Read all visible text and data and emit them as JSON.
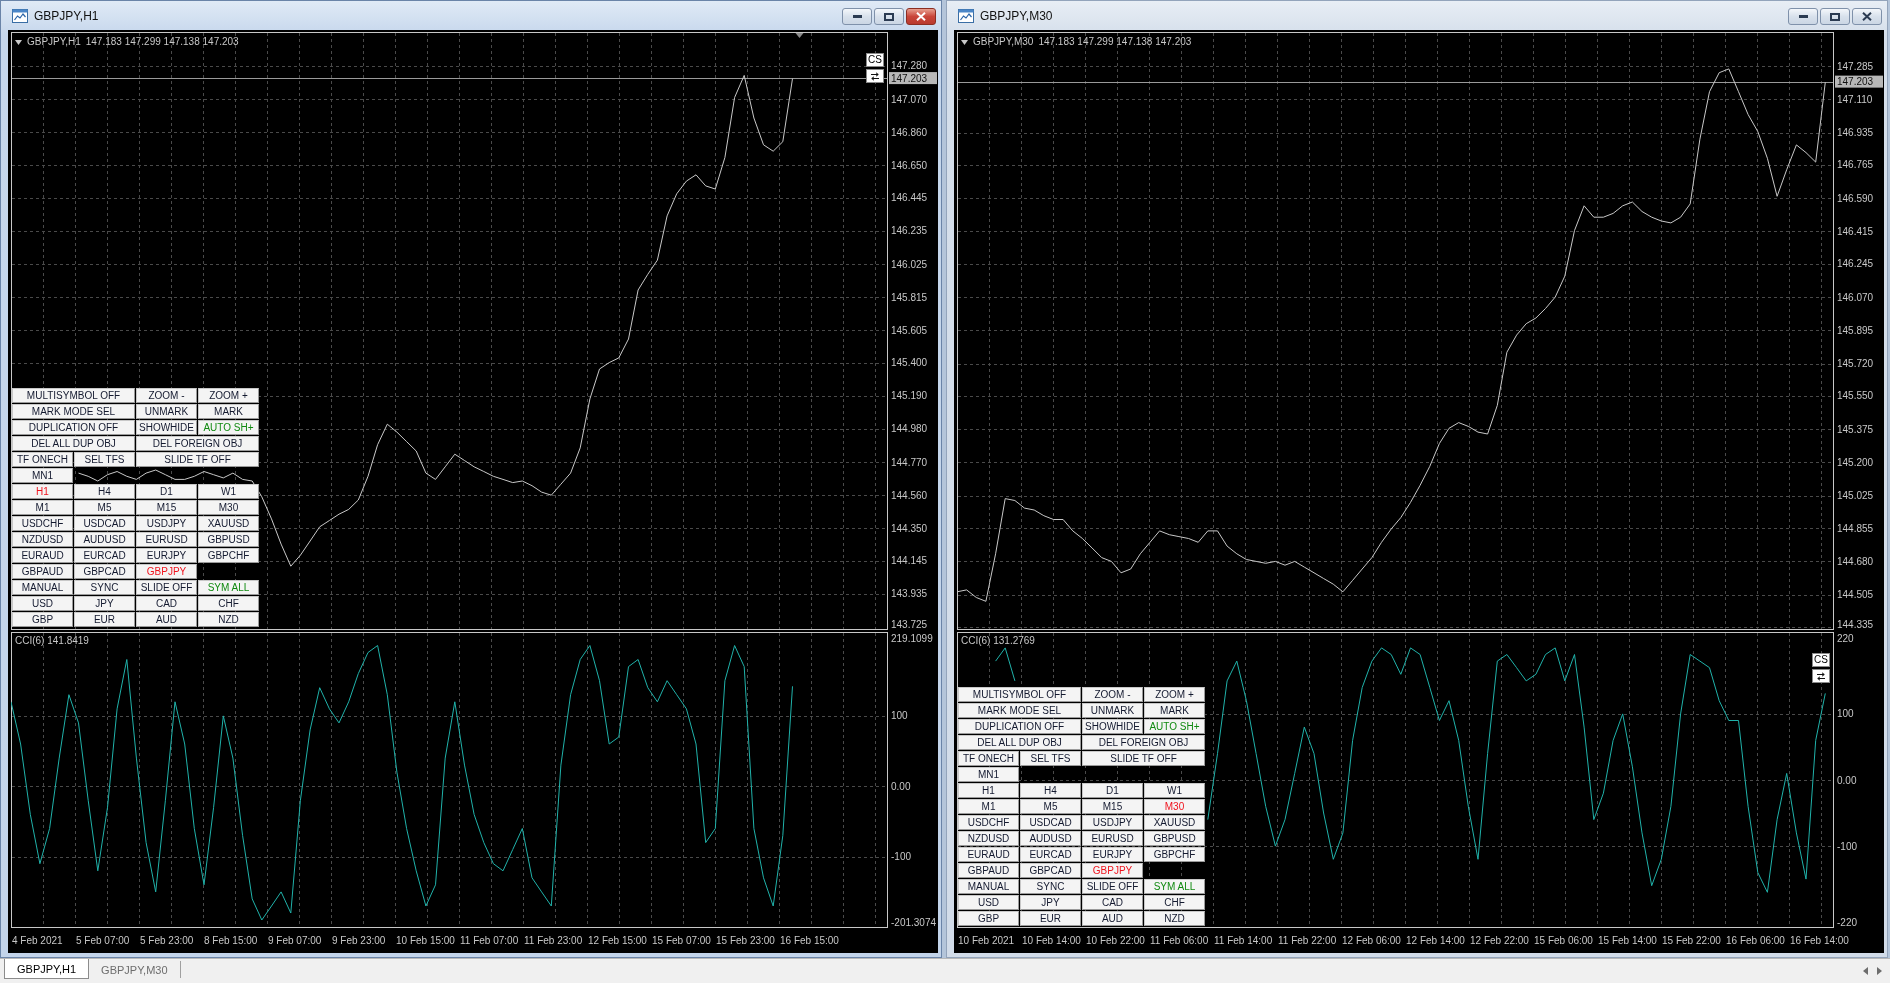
{
  "windows": [
    {
      "title": "GBPJPY,H1",
      "active": true,
      "header": {
        "symbol": "GBPJPY,H1",
        "quotes": "147.183 147.299 147.138 147.203"
      },
      "shift_marker": true,
      "price_chart": {
        "chart_data": {
          "type": "line",
          "grid": true,
          "ylim": [
            143.706,
            147.495
          ],
          "yticks": [
            {
              "value": 147.28,
              "label": "147.280"
            },
            {
              "value": 147.07,
              "label": "147.070"
            },
            {
              "value": 146.86,
              "label": "146.860"
            },
            {
              "value": 146.65,
              "label": "146.650"
            },
            {
              "value": 146.445,
              "label": "146.445"
            },
            {
              "value": 146.235,
              "label": "146.235"
            },
            {
              "value": 146.025,
              "label": "146.025"
            },
            {
              "value": 145.815,
              "label": "145.815"
            },
            {
              "value": 145.605,
              "label": "145.605"
            },
            {
              "value": 145.4,
              "label": "145.400"
            },
            {
              "value": 145.19,
              "label": "145.190"
            },
            {
              "value": 144.98,
              "label": "144.980"
            },
            {
              "value": 144.77,
              "label": "144.770"
            },
            {
              "value": 144.56,
              "label": "144.560"
            },
            {
              "value": 144.35,
              "label": "144.350"
            },
            {
              "value": 144.145,
              "label": "144.145"
            },
            {
              "value": 143.935,
              "label": "143.935"
            },
            {
              "value": 143.725,
              "label": "143.725"
            }
          ],
          "ref_lines": [
            {
              "axis": "y",
              "value": 147.203,
              "label": "147.203"
            }
          ],
          "values": [
            null,
            null,
            null,
            null,
            null,
            null,
            null,
            144.7,
            144.68,
            144.65,
            144.69,
            144.71,
            144.68,
            144.66,
            144.7,
            144.72,
            144.69,
            144.66,
            144.66,
            144.68,
            144.71,
            144.69,
            144.67,
            144.7,
            144.66,
            144.65,
            144.55,
            144.41,
            144.25,
            144.11,
            144.18,
            144.27,
            144.36,
            144.4,
            144.44,
            144.47,
            144.53,
            144.68,
            144.88,
            145.01,
            144.96,
            144.9,
            144.84,
            144.7,
            144.66,
            144.74,
            144.82,
            144.78,
            144.74,
            144.71,
            144.68,
            144.66,
            144.64,
            144.65,
            144.62,
            144.58,
            144.56,
            144.63,
            144.7,
            144.86,
            145.17,
            145.36,
            145.4,
            145.43,
            145.55,
            145.86,
            145.96,
            146.05,
            146.33,
            146.47,
            146.55,
            146.59,
            146.52,
            146.5,
            146.7,
            147.08,
            147.22,
            146.95,
            146.78,
            146.74,
            146.8,
            147.2
          ]
        },
        "corner_buttons": {
          "label": "CS"
        },
        "button_panel": {
          "rows": [
            [
              {
                "label": "MULTISYMBOL OFF",
                "wide": true,
                "selected": false,
                "on": false
              },
              {
                "label": "ZOOM -",
                "wide": false,
                "selected": false,
                "on": false
              },
              {
                "label": "ZOOM +",
                "wide": false,
                "selected": false,
                "on": false
              }
            ],
            [
              {
                "label": "MARK MODE SEL",
                "wide": true,
                "selected": false,
                "on": false
              },
              {
                "label": "UNMARK",
                "wide": false,
                "selected": false,
                "on": false
              },
              {
                "label": "MARK",
                "wide": false,
                "selected": false,
                "on": false
              }
            ],
            [
              {
                "label": "DUPLICATION OFF",
                "wide": true,
                "selected": false,
                "on": false
              },
              {
                "label": "SHOWHIDE",
                "wide": false,
                "selected": false,
                "on": false
              },
              {
                "label": "AUTO SH+",
                "wide": false,
                "selected": false,
                "on": true
              }
            ],
            [
              {
                "label": "DEL ALL DUP OBJ",
                "wide": true,
                "selected": false,
                "on": false
              },
              {
                "label": "DEL FOREIGN OBJ",
                "wide": true,
                "selected": false,
                "on": false
              }
            ],
            [
              {
                "label": "TF ONECH",
                "wide": false,
                "selected": false,
                "on": false
              },
              {
                "label": "SEL TFS",
                "wide": false,
                "selected": false,
                "on": false
              },
              {
                "label": "SLIDE TF OFF",
                "wide": true,
                "selected": false,
                "on": false
              }
            ],
            [
              {
                "label": "MN1",
                "wide": false,
                "selected": false,
                "on": false
              }
            ],
            [
              {
                "label": "H1",
                "wide": false,
                "selected": true,
                "on": false
              },
              {
                "label": "H4",
                "wide": false,
                "selected": false,
                "on": false
              },
              {
                "label": "D1",
                "wide": false,
                "selected": false,
                "on": false
              },
              {
                "label": "W1",
                "wide": false,
                "selected": false,
                "on": false
              }
            ],
            [
              {
                "label": "M1",
                "wide": false,
                "selected": false,
                "on": false
              },
              {
                "label": "M5",
                "wide": false,
                "selected": false,
                "on": false
              },
              {
                "label": "M15",
                "wide": false,
                "selected": false,
                "on": false
              },
              {
                "label": "M30",
                "wide": false,
                "selected": false,
                "on": false
              }
            ],
            [
              {
                "label": "USDCHF",
                "wide": false,
                "selected": false,
                "on": false
              },
              {
                "label": "USDCAD",
                "wide": false,
                "selected": false,
                "on": false
              },
              {
                "label": "USDJPY",
                "wide": false,
                "selected": false,
                "on": false
              },
              {
                "label": "XAUUSD",
                "wide": false,
                "selected": false,
                "on": false
              }
            ],
            [
              {
                "label": "NZDUSD",
                "wide": false,
                "selected": false,
                "on": false
              },
              {
                "label": "AUDUSD",
                "wide": false,
                "selected": false,
                "on": false
              },
              {
                "label": "EURUSD",
                "wide": false,
                "selected": false,
                "on": false
              },
              {
                "label": "GBPUSD",
                "wide": false,
                "selected": false,
                "on": false
              }
            ],
            [
              {
                "label": "EURAUD",
                "wide": false,
                "selected": false,
                "on": false
              },
              {
                "label": "EURCAD",
                "wide": false,
                "selected": false,
                "on": false
              },
              {
                "label": "EURJPY",
                "wide": false,
                "selected": false,
                "on": false
              },
              {
                "label": "GBPCHF",
                "wide": false,
                "selected": false,
                "on": false
              }
            ],
            [
              {
                "label": "GBPAUD",
                "wide": false,
                "selected": false,
                "on": false
              },
              {
                "label": "GBPCAD",
                "wide": false,
                "selected": false,
                "on": false
              },
              {
                "label": "GBPJPY",
                "wide": false,
                "selected": true,
                "on": false
              }
            ],
            [
              {
                "label": "MANUAL",
                "wide": false,
                "selected": false,
                "on": false
              },
              {
                "label": "SYNC",
                "wide": false,
                "selected": false,
                "on": false
              },
              {
                "label": "SLIDE OFF",
                "wide": false,
                "selected": false,
                "on": false
              },
              {
                "label": "SYM ALL",
                "wide": false,
                "selected": false,
                "on": true
              }
            ],
            [
              {
                "label": "USD",
                "wide": false,
                "selected": false,
                "on": false
              },
              {
                "label": "JPY",
                "wide": false,
                "selected": false,
                "on": false
              },
              {
                "label": "CAD",
                "wide": false,
                "selected": false,
                "on": false
              },
              {
                "label": "CHF",
                "wide": false,
                "selected": false,
                "on": false
              }
            ],
            [
              {
                "label": "GBP",
                "wide": false,
                "selected": false,
                "on": false
              },
              {
                "label": "EUR",
                "wide": false,
                "selected": false,
                "on": false
              },
              {
                "label": "AUD",
                "wide": false,
                "selected": false,
                "on": false
              },
              {
                "label": "NZD",
                "wide": false,
                "selected": false,
                "on": false
              }
            ]
          ]
        }
      },
      "indicator": {
        "label": "CCI(6) 141.8419",
        "chart_data": {
          "type": "line",
          "grid": true,
          "ylim": [
            -201.3074,
            219.1099
          ],
          "yticks": [
            {
              "value": 219.1099,
              "label": "219.1099"
            },
            {
              "value": 100,
              "label": "100"
            },
            {
              "value": 0,
              "label": "0.00"
            },
            {
              "value": -100,
              "label": "-100"
            },
            {
              "value": -201.3074,
              "label": "-201.3074"
            }
          ],
          "values": [
            120,
            60,
            -40,
            -110,
            -60,
            40,
            130,
            90,
            -20,
            -120,
            -30,
            110,
            180,
            40,
            -80,
            -150,
            -20,
            120,
            60,
            -60,
            -140,
            -30,
            100,
            40,
            -70,
            -160,
            -190,
            -170,
            -150,
            -180,
            -20,
            80,
            140,
            110,
            90,
            120,
            160,
            190,
            200,
            130,
            20,
            -60,
            -120,
            -170,
            -140,
            40,
            120,
            30,
            -40,
            -80,
            -110,
            -120,
            -90,
            -60,
            -130,
            -150,
            -170,
            30,
            130,
            180,
            200,
            150,
            60,
            70,
            170,
            180,
            140,
            120,
            150,
            130,
            110,
            60,
            -80,
            -60,
            150,
            200,
            170,
            -60,
            -130,
            -170,
            -70,
            142
          ]
        }
      },
      "time_axis": [
        "4 Feb 2021",
        "5 Feb 07:00",
        "5 Feb 23:00",
        "8 Feb 15:00",
        "9 Feb 07:00",
        "9 Feb 23:00",
        "10 Feb 15:00",
        "11 Feb 07:00",
        "11 Feb 23:00",
        "12 Feb 15:00",
        "15 Feb 07:00",
        "15 Feb 23:00",
        "16 Feb 15:00"
      ]
    },
    {
      "title": "GBPJPY,M30",
      "active": false,
      "header": {
        "symbol": "GBPJPY,M30",
        "quotes": "147.183 147.299 147.138 147.203"
      },
      "shift_marker": false,
      "price_chart": {
        "chart_data": {
          "type": "line",
          "grid": true,
          "ylim": [
            144.319,
            147.464
          ],
          "yticks": [
            {
              "value": 147.285,
              "label": "147.285"
            },
            {
              "value": 147.11,
              "label": "147.110"
            },
            {
              "value": 146.935,
              "label": "146.935"
            },
            {
              "value": 146.765,
              "label": "146.765"
            },
            {
              "value": 146.59,
              "label": "146.590"
            },
            {
              "value": 146.415,
              "label": "146.415"
            },
            {
              "value": 146.245,
              "label": "146.245"
            },
            {
              "value": 146.07,
              "label": "146.070"
            },
            {
              "value": 145.895,
              "label": "145.895"
            },
            {
              "value": 145.72,
              "label": "145.720"
            },
            {
              "value": 145.55,
              "label": "145.550"
            },
            {
              "value": 145.375,
              "label": "145.375"
            },
            {
              "value": 145.2,
              "label": "145.200"
            },
            {
              "value": 145.025,
              "label": "145.025"
            },
            {
              "value": 144.855,
              "label": "144.855"
            },
            {
              "value": 144.68,
              "label": "144.680"
            },
            {
              "value": 144.505,
              "label": "144.505"
            },
            {
              "value": 144.335,
              "label": "144.335"
            }
          ],
          "ref_lines": [
            {
              "axis": "y",
              "value": 147.203,
              "label": "147.203"
            }
          ],
          "values": [
            144.52,
            144.53,
            144.49,
            144.47,
            144.72,
            145.01,
            145.0,
            144.96,
            144.95,
            144.92,
            144.9,
            144.9,
            144.84,
            144.8,
            144.75,
            144.7,
            144.68,
            144.62,
            144.64,
            144.72,
            144.78,
            144.84,
            144.82,
            144.81,
            144.8,
            144.78,
            144.84,
            144.84,
            144.76,
            144.72,
            144.69,
            144.68,
            144.67,
            144.68,
            144.66,
            144.68,
            144.65,
            144.62,
            144.59,
            144.56,
            144.52,
            144.58,
            144.64,
            144.7,
            144.78,
            144.85,
            144.91,
            144.99,
            145.08,
            145.18,
            145.3,
            145.38,
            145.41,
            145.39,
            145.36,
            145.35,
            145.5,
            145.78,
            145.87,
            145.93,
            145.96,
            146.01,
            146.07,
            146.18,
            146.42,
            146.55,
            146.49,
            146.49,
            146.51,
            146.55,
            146.57,
            146.52,
            146.49,
            146.47,
            146.46,
            146.49,
            146.56,
            146.9,
            147.15,
            147.25,
            147.27,
            147.15,
            147.03,
            146.94,
            146.8,
            146.6,
            146.74,
            146.87,
            146.83,
            146.78,
            147.2
          ]
        }
      },
      "indicator": {
        "label": "CCI(6) 131.2769",
        "chart_data": {
          "type": "line",
          "grid": true,
          "ylim": [
            -224,
            224
          ],
          "yticks": [
            {
              "value": 220,
              "label": "220"
            },
            {
              "value": 100,
              "label": "100"
            },
            {
              "value": 0,
              "label": "0.00"
            },
            {
              "value": -100,
              "label": "-100"
            },
            {
              "value": -220,
              "label": "-220"
            }
          ],
          "values": [
            null,
            null,
            null,
            null,
            180,
            200,
            150,
            null,
            null,
            null,
            null,
            null,
            null,
            null,
            null,
            null,
            null,
            null,
            null,
            null,
            null,
            null,
            null,
            null,
            null,
            null,
            -60,
            40,
            150,
            180,
            120,
            40,
            -40,
            -100,
            -60,
            10,
            80,
            40,
            -50,
            -120,
            -80,
            60,
            140,
            180,
            200,
            190,
            160,
            200,
            190,
            140,
            90,
            120,
            60,
            -40,
            -120,
            40,
            180,
            190,
            170,
            150,
            160,
            190,
            200,
            150,
            190,
            80,
            -60,
            -20,
            60,
            100,
            20,
            -80,
            -160,
            -120,
            -40,
            100,
            190,
            180,
            170,
            120,
            90,
            90,
            -40,
            -140,
            -170,
            -60,
            10,
            -80,
            -150,
            60,
            131
          ]
        },
        "corner_buttons": {
          "label": "CS"
        },
        "button_panel": {
          "rows": [
            [
              {
                "label": "MULTISYMBOL OFF",
                "wide": true,
                "selected": false,
                "on": false
              },
              {
                "label": "ZOOM -",
                "wide": false,
                "selected": false,
                "on": false
              },
              {
                "label": "ZOOM +",
                "wide": false,
                "selected": false,
                "on": false
              }
            ],
            [
              {
                "label": "MARK MODE SEL",
                "wide": true,
                "selected": false,
                "on": false
              },
              {
                "label": "UNMARK",
                "wide": false,
                "selected": false,
                "on": false
              },
              {
                "label": "MARK",
                "wide": false,
                "selected": false,
                "on": false
              }
            ],
            [
              {
                "label": "DUPLICATION OFF",
                "wide": true,
                "selected": false,
                "on": false
              },
              {
                "label": "SHOWHIDE",
                "wide": false,
                "selected": false,
                "on": false
              },
              {
                "label": "AUTO SH+",
                "wide": false,
                "selected": false,
                "on": true
              }
            ],
            [
              {
                "label": "DEL ALL DUP OBJ",
                "wide": true,
                "selected": false,
                "on": false
              },
              {
                "label": "DEL FOREIGN OBJ",
                "wide": true,
                "selected": false,
                "on": false
              }
            ],
            [
              {
                "label": "TF ONECH",
                "wide": false,
                "selected": false,
                "on": false
              },
              {
                "label": "SEL TFS",
                "wide": false,
                "selected": false,
                "on": false
              },
              {
                "label": "SLIDE TF OFF",
                "wide": true,
                "selected": false,
                "on": false
              }
            ],
            [
              {
                "label": "MN1",
                "wide": false,
                "selected": false,
                "on": false
              }
            ],
            [
              {
                "label": "H1",
                "wide": false,
                "selected": false,
                "on": false
              },
              {
                "label": "H4",
                "wide": false,
                "selected": false,
                "on": false
              },
              {
                "label": "D1",
                "wide": false,
                "selected": false,
                "on": false
              },
              {
                "label": "W1",
                "wide": false,
                "selected": false,
                "on": false
              }
            ],
            [
              {
                "label": "M1",
                "wide": false,
                "selected": false,
                "on": false
              },
              {
                "label": "M5",
                "wide": false,
                "selected": false,
                "on": false
              },
              {
                "label": "M15",
                "wide": false,
                "selected": false,
                "on": false
              },
              {
                "label": "M30",
                "wide": false,
                "selected": true,
                "on": false
              }
            ],
            [
              {
                "label": "USDCHF",
                "wide": false,
                "selected": false,
                "on": false
              },
              {
                "label": "USDCAD",
                "wide": false,
                "selected": false,
                "on": false
              },
              {
                "label": "USDJPY",
                "wide": false,
                "selected": false,
                "on": false
              },
              {
                "label": "XAUUSD",
                "wide": false,
                "selected": false,
                "on": false
              }
            ],
            [
              {
                "label": "NZDUSD",
                "wide": false,
                "selected": false,
                "on": false
              },
              {
                "label": "AUDUSD",
                "wide": false,
                "selected": false,
                "on": false
              },
              {
                "label": "EURUSD",
                "wide": false,
                "selected": false,
                "on": false
              },
              {
                "label": "GBPUSD",
                "wide": false,
                "selected": false,
                "on": false
              }
            ],
            [
              {
                "label": "EURAUD",
                "wide": false,
                "selected": false,
                "on": false
              },
              {
                "label": "EURCAD",
                "wide": false,
                "selected": false,
                "on": false
              },
              {
                "label": "EURJPY",
                "wide": false,
                "selected": false,
                "on": false
              },
              {
                "label": "GBPCHF",
                "wide": false,
                "selected": false,
                "on": false
              }
            ],
            [
              {
                "label": "GBPAUD",
                "wide": false,
                "selected": false,
                "on": false
              },
              {
                "label": "GBPCAD",
                "wide": false,
                "selected": false,
                "on": false
              },
              {
                "label": "GBPJPY",
                "wide": false,
                "selected": true,
                "on": false
              }
            ],
            [
              {
                "label": "MANUAL",
                "wide": false,
                "selected": false,
                "on": false
              },
              {
                "label": "SYNC",
                "wide": false,
                "selected": false,
                "on": false
              },
              {
                "label": "SLIDE OFF",
                "wide": false,
                "selected": false,
                "on": false
              },
              {
                "label": "SYM ALL",
                "wide": false,
                "selected": false,
                "on": true
              }
            ],
            [
              {
                "label": "USD",
                "wide": false,
                "selected": false,
                "on": false
              },
              {
                "label": "JPY",
                "wide": false,
                "selected": false,
                "on": false
              },
              {
                "label": "CAD",
                "wide": false,
                "selected": false,
                "on": false
              },
              {
                "label": "CHF",
                "wide": false,
                "selected": false,
                "on": false
              }
            ],
            [
              {
                "label": "GBP",
                "wide": false,
                "selected": false,
                "on": false
              },
              {
                "label": "EUR",
                "wide": false,
                "selected": false,
                "on": false
              },
              {
                "label": "AUD",
                "wide": false,
                "selected": false,
                "on": false
              },
              {
                "label": "NZD",
                "wide": false,
                "selected": false,
                "on": false
              }
            ]
          ]
        }
      },
      "time_axis": [
        "10 Feb 2021",
        "10 Feb 14:00",
        "10 Feb 22:00",
        "11 Feb 06:00",
        "11 Feb 14:00",
        "11 Feb 22:00",
        "12 Feb 06:00",
        "12 Feb 14:00",
        "12 Feb 22:00",
        "15 Feb 06:00",
        "15 Feb 14:00",
        "15 Feb 22:00",
        "16 Feb 06:00",
        "16 Feb 14:00"
      ]
    }
  ],
  "tab_bar": {
    "tabs": [
      {
        "label": "GBPJPY,H1",
        "selected": true
      },
      {
        "label": "GBPJPY,M30",
        "selected": false
      }
    ]
  }
}
